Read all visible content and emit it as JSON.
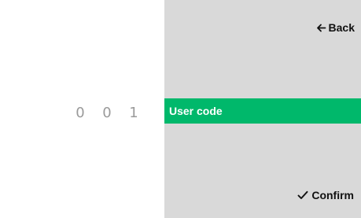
{
  "code": {
    "digits": [
      "0",
      "0",
      "1"
    ]
  },
  "menu": {
    "selected_item_label": "User code"
  },
  "actions": {
    "back_label": "Back",
    "confirm_label": "Confirm"
  },
  "colors": {
    "accent": "#00b86b",
    "right_panel_bg": "#d9d9d9",
    "digit_color": "#9a9a9a"
  },
  "icons": {
    "back": "arrow-left-icon",
    "confirm": "checkmark-icon"
  }
}
